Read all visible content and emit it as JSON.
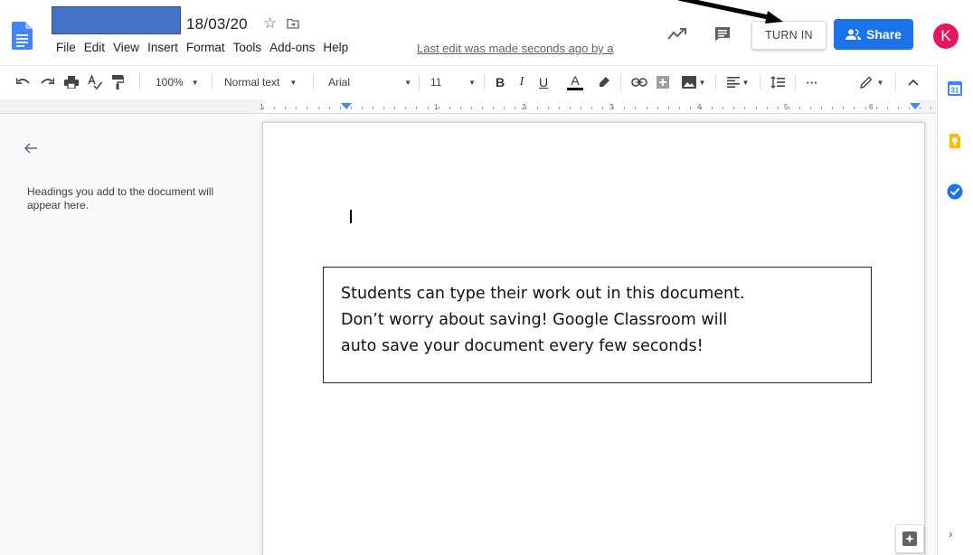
{
  "header": {
    "doc_title": "18/03/20",
    "last_edit": "Last edit was made seconds ago by a",
    "turn_in_label": "TURN IN",
    "share_label": "Share",
    "avatar_initial": "K",
    "colors": {
      "share": "#1a73e8",
      "avatar": "#e8175d",
      "title_redaction": "#4472c4"
    }
  },
  "menubar": {
    "items": [
      "File",
      "Edit",
      "View",
      "Insert",
      "Format",
      "Tools",
      "Add-ons",
      "Help"
    ]
  },
  "toolbar": {
    "zoom": "100%",
    "style": "Normal text",
    "font": "Arial",
    "font_size": "11",
    "bold": "B",
    "italic": "I",
    "underline": "U",
    "text_color": "A",
    "more": "···"
  },
  "ruler": {
    "labels": [
      "1",
      "1",
      "2",
      "3",
      "4",
      "5",
      "6"
    ]
  },
  "outline": {
    "placeholder": "Headings you add to the document will appear here."
  },
  "callout": {
    "lines": [
      "Students can type their work out in this document.",
      "Don’t worry about saving! Google Classroom will",
      "auto save your document every few seconds!"
    ]
  },
  "side_panel": {
    "icons": [
      "calendar-icon",
      "keep-icon",
      "tasks-icon"
    ],
    "calendar_label": "31"
  }
}
